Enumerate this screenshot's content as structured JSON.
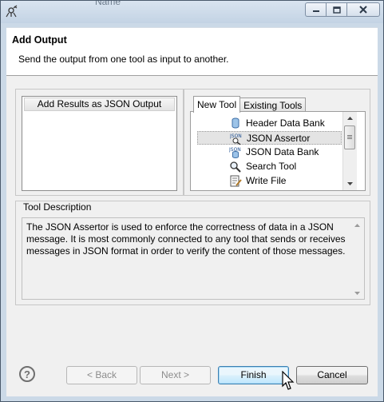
{
  "window": {
    "background_title_text": "Name",
    "buttons": [
      "minimize",
      "restore",
      "close"
    ]
  },
  "header": {
    "title": "Add Output",
    "description": "Send the output from one tool as input to another."
  },
  "left_panel": {
    "column_header": "Add Results as JSON Output"
  },
  "tabs": [
    {
      "label": "New Tool",
      "active": true
    },
    {
      "label": "Existing Tools",
      "active": false
    }
  ],
  "tools": [
    {
      "label": "Header Data Bank",
      "icon": "data-bank-icon",
      "selected": false
    },
    {
      "label": "JSON Assertor",
      "icon": "json-assertor-icon",
      "selected": true
    },
    {
      "label": "JSON Data Bank",
      "icon": "json-data-bank-icon",
      "selected": false
    },
    {
      "label": "Search Tool",
      "icon": "search-tool-icon",
      "selected": false
    },
    {
      "label": "Write File",
      "icon": "write-file-icon",
      "selected": false
    }
  ],
  "tool_description": {
    "label": "Tool Description",
    "text": "The JSON Assertor is used to enforce the correctness of data in a JSON message. It is most commonly connected to any tool that sends or receives messages in JSON format in order to verify the content of those messages."
  },
  "footer": {
    "help_glyph": "?",
    "back_label": "< Back",
    "next_label": "Next >",
    "finish_label": "Finish",
    "cancel_label": "Cancel"
  },
  "colors": {
    "frame": "#cbd9e7",
    "focus_border": "#3c7fb1",
    "disabled_text": "#8c8c8c"
  }
}
